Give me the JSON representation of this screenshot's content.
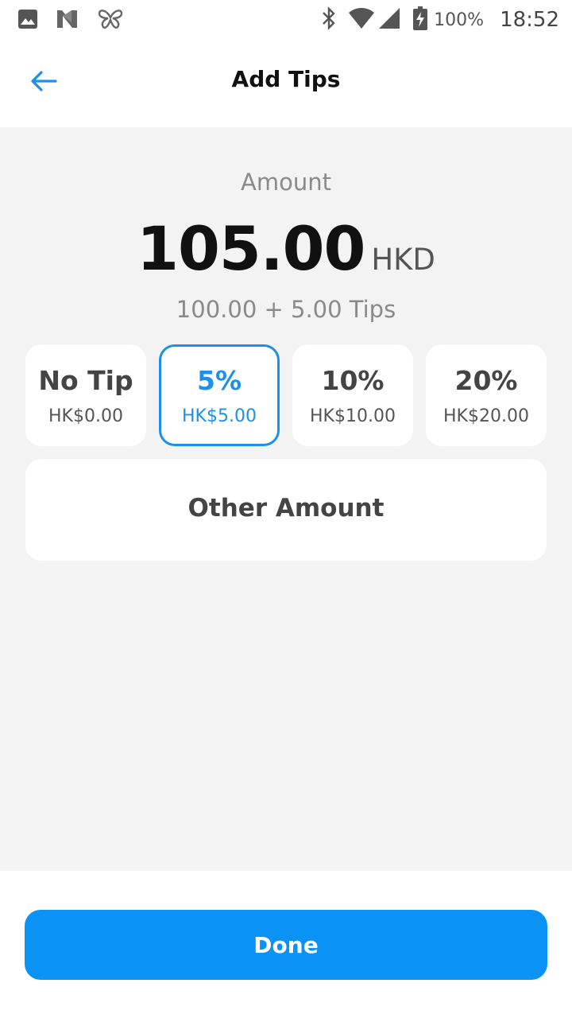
{
  "status_bar": {
    "icons_left": [
      "image-icon",
      "n-logo-icon",
      "butterfly-icon"
    ],
    "icons_right": [
      "bluetooth-icon",
      "wifi-icon",
      "cell-signal-icon",
      "battery-charging-icon"
    ],
    "battery": "100%",
    "time": "18:52"
  },
  "header": {
    "back_icon": "arrow-left-icon",
    "title": "Add Tips"
  },
  "amount": {
    "label": "Amount",
    "value": "105.00",
    "currency": "HKD",
    "breakdown": "100.00 + 5.00 Tips"
  },
  "tip_options": [
    {
      "label": "No Tip",
      "amount": "HK$0.00",
      "selected": false
    },
    {
      "label": "5%",
      "amount": "HK$5.00",
      "selected": true
    },
    {
      "label": "10%",
      "amount": "HK$10.00",
      "selected": false
    },
    {
      "label": "20%",
      "amount": "HK$20.00",
      "selected": false
    }
  ],
  "other_amount": {
    "label": "Other Amount"
  },
  "footer": {
    "done_label": "Done"
  },
  "colors": {
    "accent": "#1e90e8",
    "button": "#0a93f5",
    "background": "#f3f3f3"
  }
}
